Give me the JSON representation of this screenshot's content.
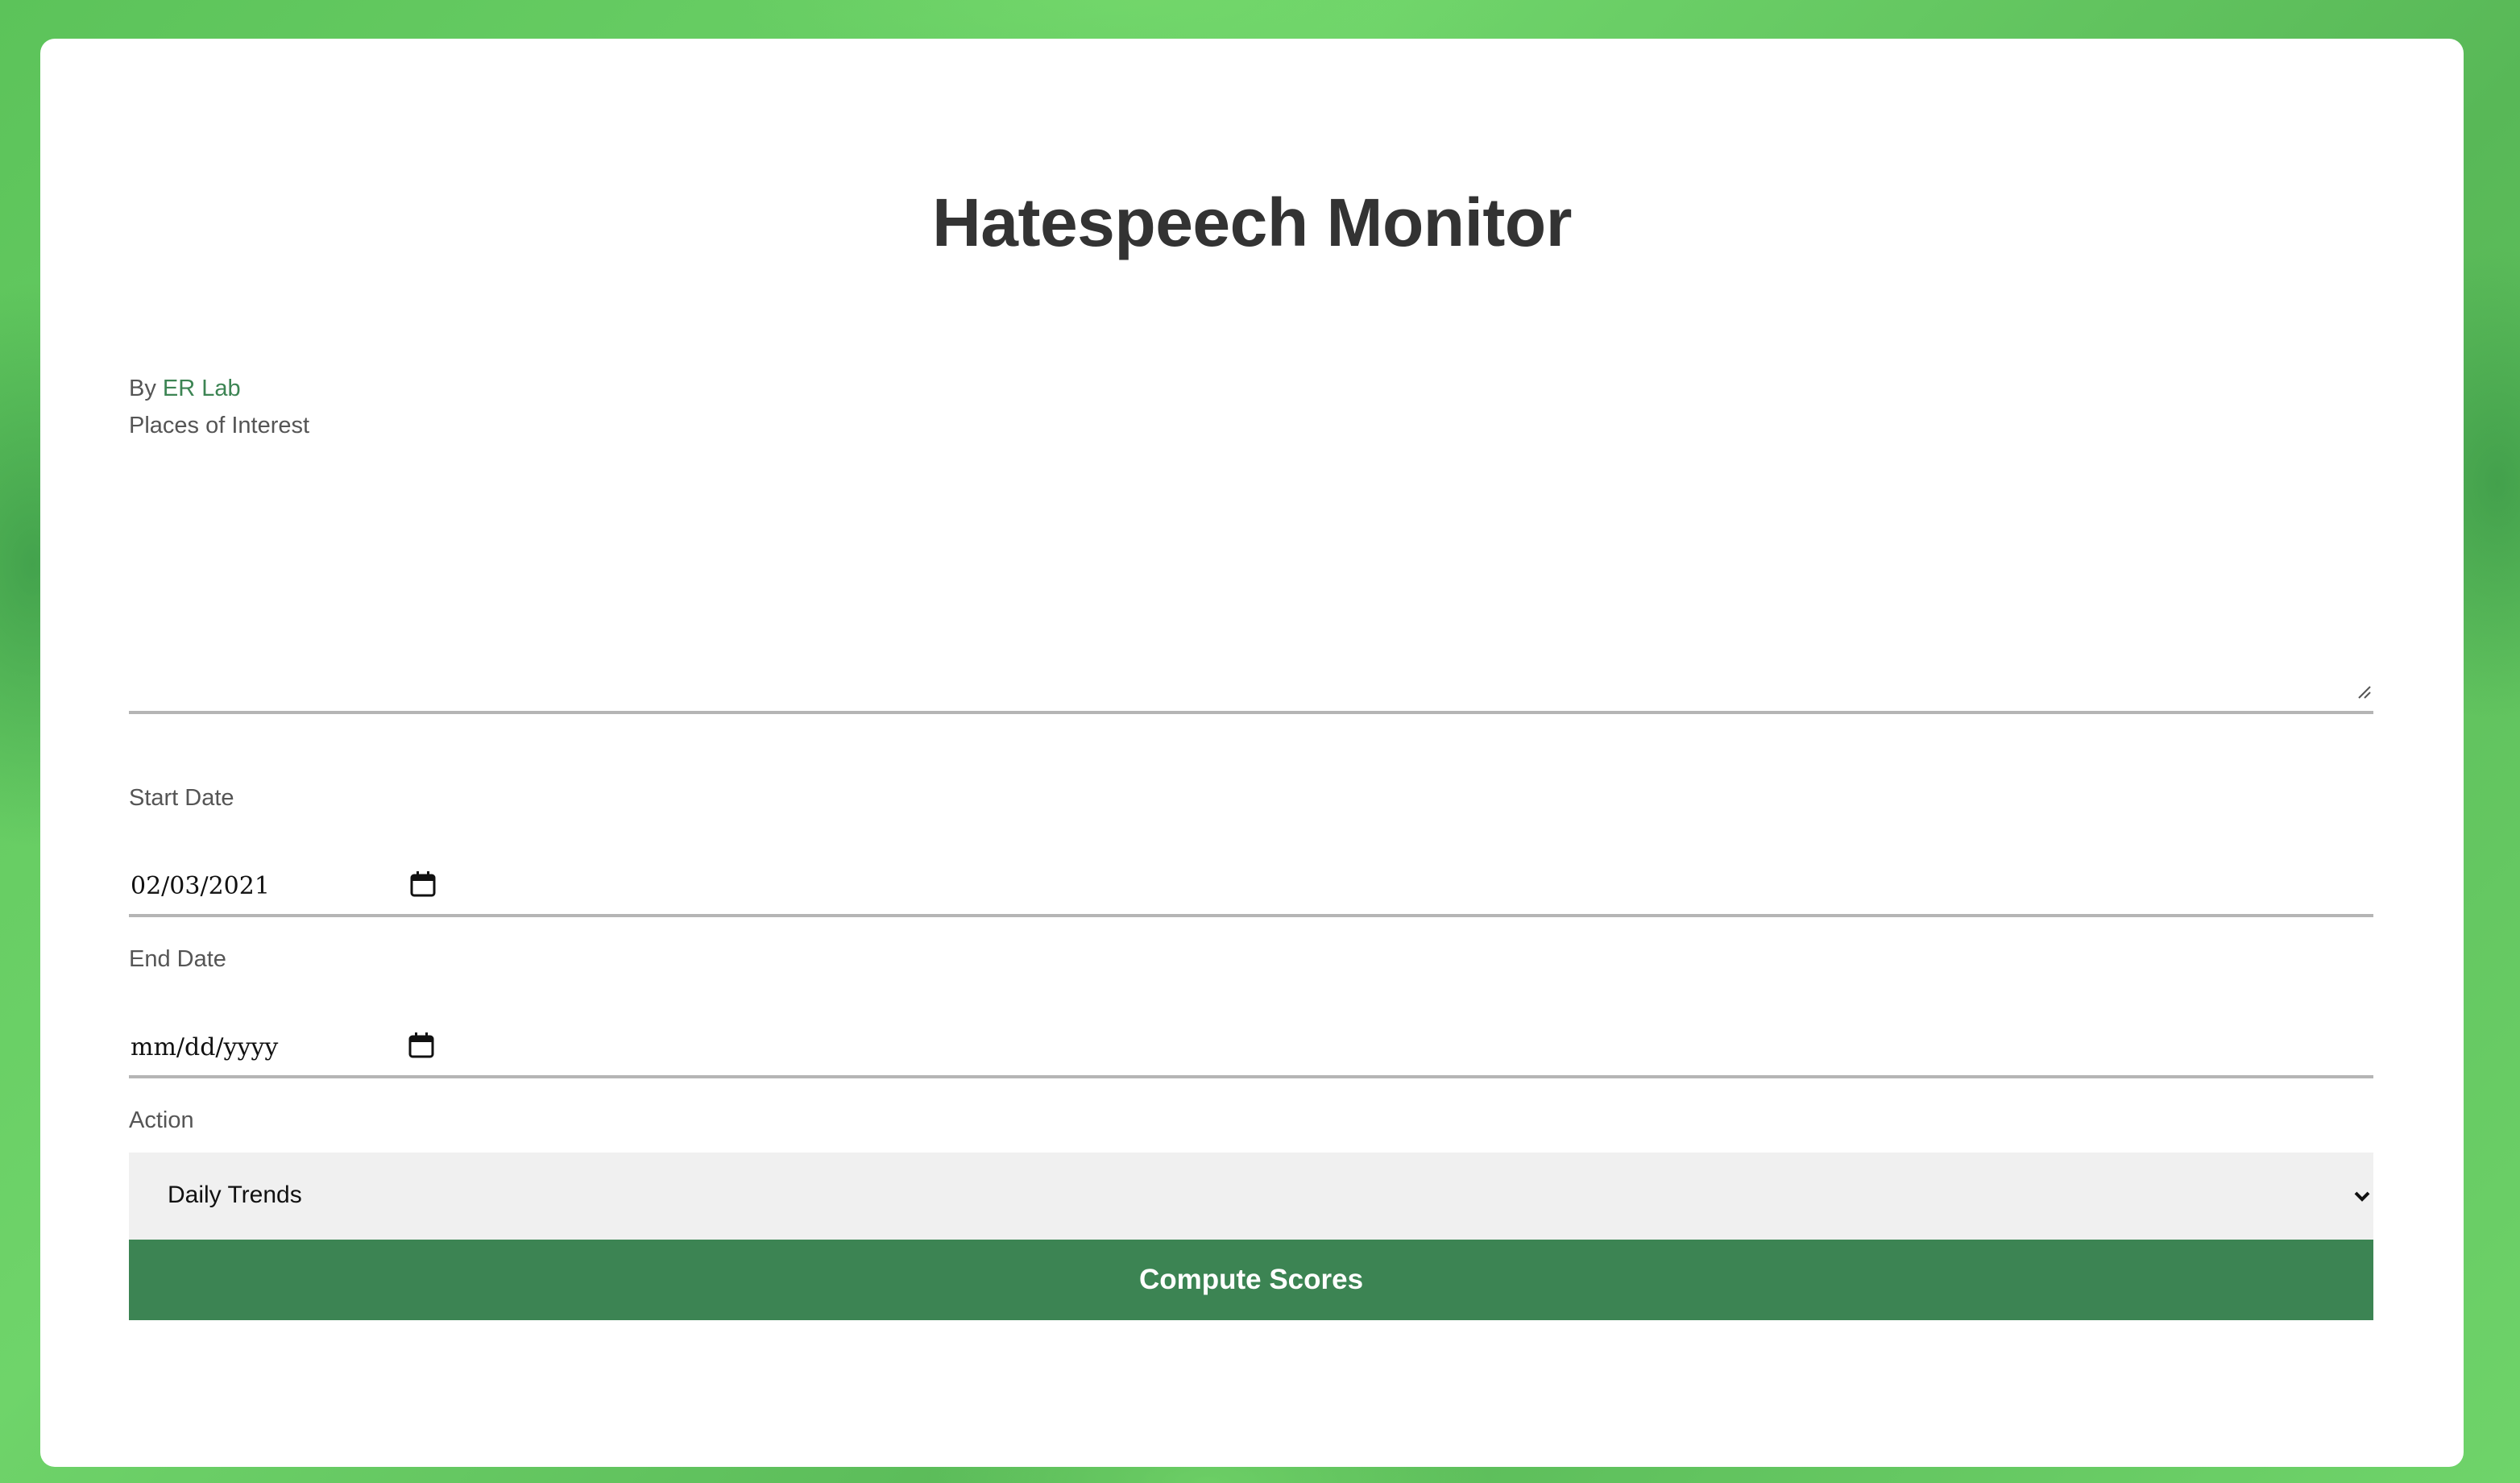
{
  "page": {
    "title": "Hatespeech Monitor",
    "byline_prefix": "By",
    "byline_link": "ER Lab"
  },
  "form": {
    "places_label": "Places of Interest",
    "places_value": "",
    "start_date_label": "Start Date",
    "start_date_value": "02/03/2021",
    "end_date_label": "End Date",
    "end_date_placeholder": "mm/dd/yyyy",
    "action_label": "Action",
    "action_selected": "Daily Trends",
    "submit_label": "Compute Scores"
  },
  "colors": {
    "accent": "#3c8453",
    "title": "#333333",
    "background": "#5cc35a"
  },
  "icons": [
    "calendar-icon",
    "chevron-down-icon",
    "resize-handle-icon"
  ]
}
